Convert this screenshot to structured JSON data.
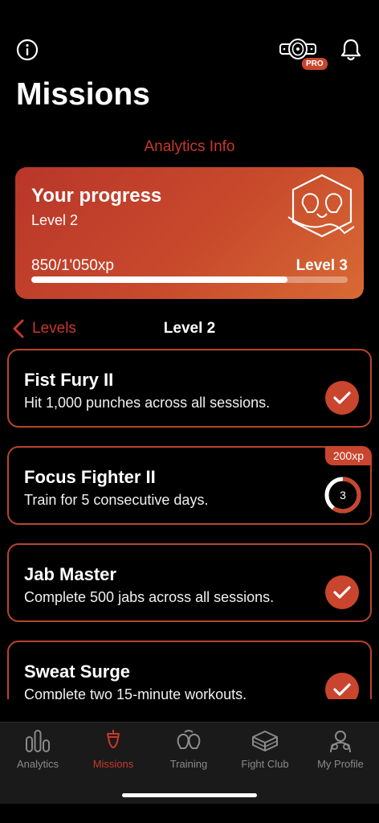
{
  "header": {
    "title": "Missions",
    "pro_badge": "PRO",
    "icons": [
      "info-icon",
      "championship-belt-icon",
      "bell-icon"
    ]
  },
  "analytics_link": "Analytics Info",
  "progress": {
    "title": "Your progress",
    "level": "Level 2",
    "xp_text": "850/1'050xp",
    "next_level": "Level 3",
    "fraction": 0.81,
    "icon": "boxing-gloves-emblem-icon"
  },
  "levels_nav": {
    "back_label": "Levels",
    "current": "Level 2"
  },
  "missions": [
    {
      "title": "Fist Fury II",
      "desc": "Hit 1,000 punches across all sessions.",
      "status": "complete"
    },
    {
      "title": "Focus Fighter II",
      "desc": "Train for 5 consecutive days.",
      "status": "in_progress",
      "xp": "200xp",
      "progress_value": "3",
      "progress_fraction": 0.6
    },
    {
      "title": "Jab Master",
      "desc": "Complete 500 jabs across all sessions.",
      "status": "complete"
    },
    {
      "title": "Sweat Surge",
      "desc": "Complete two 15-minute workouts.",
      "status": "complete"
    }
  ],
  "tabs": [
    {
      "label": "Analytics",
      "icon": "analytics-bars-icon",
      "active": false
    },
    {
      "label": "Missions",
      "icon": "punching-bag-icon",
      "active": true
    },
    {
      "label": "Training",
      "icon": "boxing-gloves-icon",
      "active": false
    },
    {
      "label": "Fight Club",
      "icon": "boxing-ring-icon",
      "active": false
    },
    {
      "label": "My Profile",
      "icon": "boxer-profile-icon",
      "active": false
    }
  ],
  "colors": {
    "accent": "#c9382a",
    "card_border": "#b8442e",
    "check_bg": "#c9452e",
    "tab_inactive": "#8a8a8a"
  }
}
